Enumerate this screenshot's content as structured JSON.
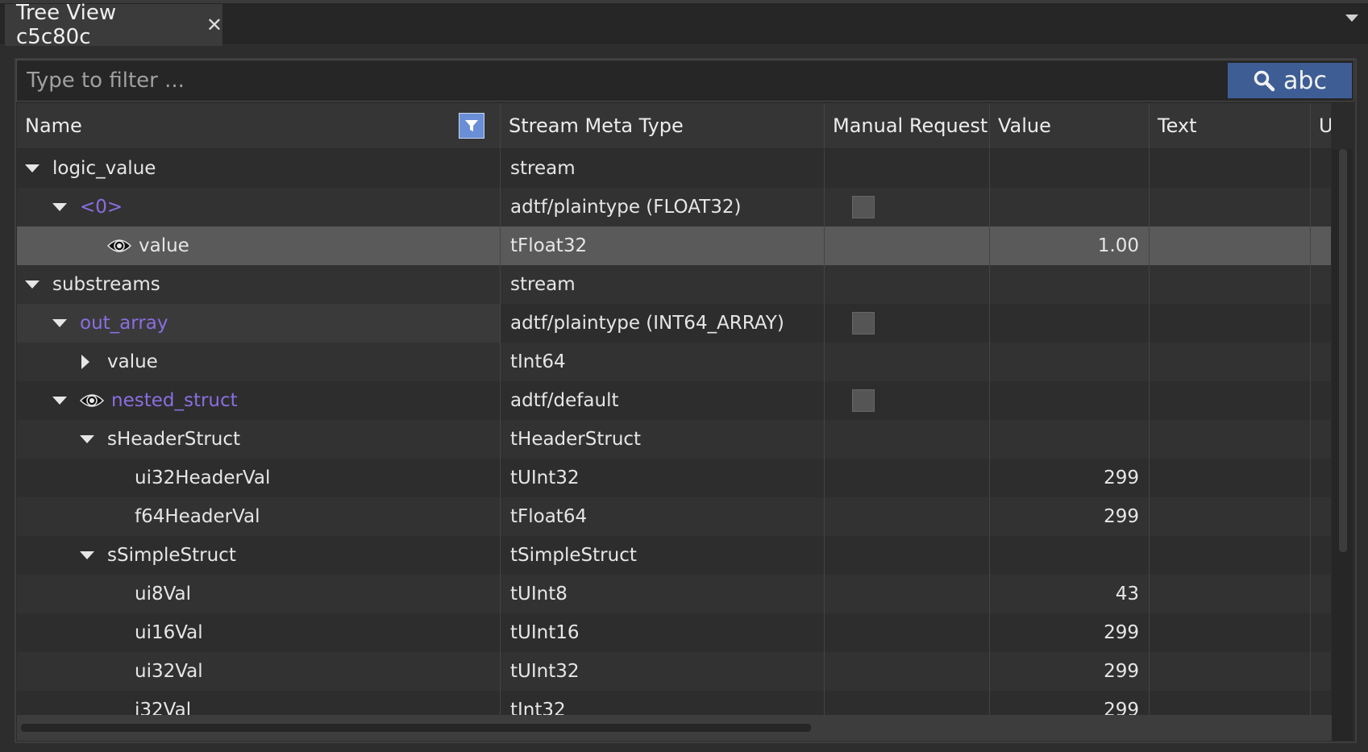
{
  "tab": {
    "title": "Tree View c5c80c",
    "close": "✕"
  },
  "filter": {
    "placeholder": "Type to filter ...",
    "value": "",
    "mode_label": "abc"
  },
  "columns": [
    "Name",
    "Stream Meta Type",
    "Manual Request",
    "Value",
    "Text",
    "U"
  ],
  "rows": [
    {
      "name": "logic_value",
      "type": "stream",
      "value": "",
      "depth": 0,
      "expander": "down",
      "purple": false,
      "eye": false,
      "checkbox": false
    },
    {
      "name": "<0>",
      "type": "adtf/plaintype (FLOAT32)",
      "value": "",
      "depth": 1,
      "expander": "down",
      "purple": true,
      "eye": false,
      "checkbox": true
    },
    {
      "name": "value",
      "type": "tFloat32",
      "value": "1.00",
      "depth": 2,
      "expander": "none",
      "purple": false,
      "eye": true,
      "checkbox": false,
      "selected": true
    },
    {
      "name": "substreams",
      "type": "stream",
      "value": "",
      "depth": 0,
      "expander": "down",
      "purple": false,
      "eye": false,
      "checkbox": false
    },
    {
      "name": "out_array",
      "type": "adtf/plaintype (INT64_ARRAY)",
      "value": "",
      "depth": 1,
      "expander": "down",
      "purple": true,
      "eye": false,
      "checkbox": true,
      "hover": true
    },
    {
      "name": "value",
      "type": "tInt64",
      "value": "",
      "depth": 2,
      "expander": "right",
      "purple": false,
      "eye": false,
      "checkbox": false
    },
    {
      "name": "nested_struct",
      "type": "adtf/default",
      "value": "",
      "depth": 1,
      "expander": "down",
      "purple": true,
      "eye": true,
      "checkbox": true
    },
    {
      "name": "sHeaderStruct",
      "type": "tHeaderStruct",
      "value": "",
      "depth": 2,
      "expander": "down",
      "purple": false,
      "eye": false,
      "checkbox": false
    },
    {
      "name": "ui32HeaderVal",
      "type": "tUInt32",
      "value": "299",
      "depth": 3,
      "expander": "none",
      "purple": false,
      "eye": false,
      "checkbox": false
    },
    {
      "name": "f64HeaderVal",
      "type": "tFloat64",
      "value": "299",
      "depth": 3,
      "expander": "none",
      "purple": false,
      "eye": false,
      "checkbox": false
    },
    {
      "name": "sSimpleStruct",
      "type": "tSimpleStruct",
      "value": "",
      "depth": 2,
      "expander": "down",
      "purple": false,
      "eye": false,
      "checkbox": false
    },
    {
      "name": "ui8Val",
      "type": "tUInt8",
      "value": "43",
      "depth": 3,
      "expander": "none",
      "purple": false,
      "eye": false,
      "checkbox": false
    },
    {
      "name": "ui16Val",
      "type": "tUInt16",
      "value": "299",
      "depth": 3,
      "expander": "none",
      "purple": false,
      "eye": false,
      "checkbox": false
    },
    {
      "name": "ui32Val",
      "type": "tUInt32",
      "value": "299",
      "depth": 3,
      "expander": "none",
      "purple": false,
      "eye": false,
      "checkbox": false
    },
    {
      "name": "i32Val",
      "type": "tInt32",
      "value": "299",
      "depth": 3,
      "expander": "none",
      "purple": false,
      "eye": false,
      "checkbox": false
    }
  ],
  "colors": {
    "accent": "#3e5d94",
    "link_purple": "#8a6ee0",
    "filter_toggle": "#6a8fd6",
    "selected_row": "#5a5a5a"
  },
  "icons": {
    "search": "magnifier-icon",
    "filter": "funnel-icon",
    "visible": "eye-icon",
    "close": "close-icon"
  }
}
